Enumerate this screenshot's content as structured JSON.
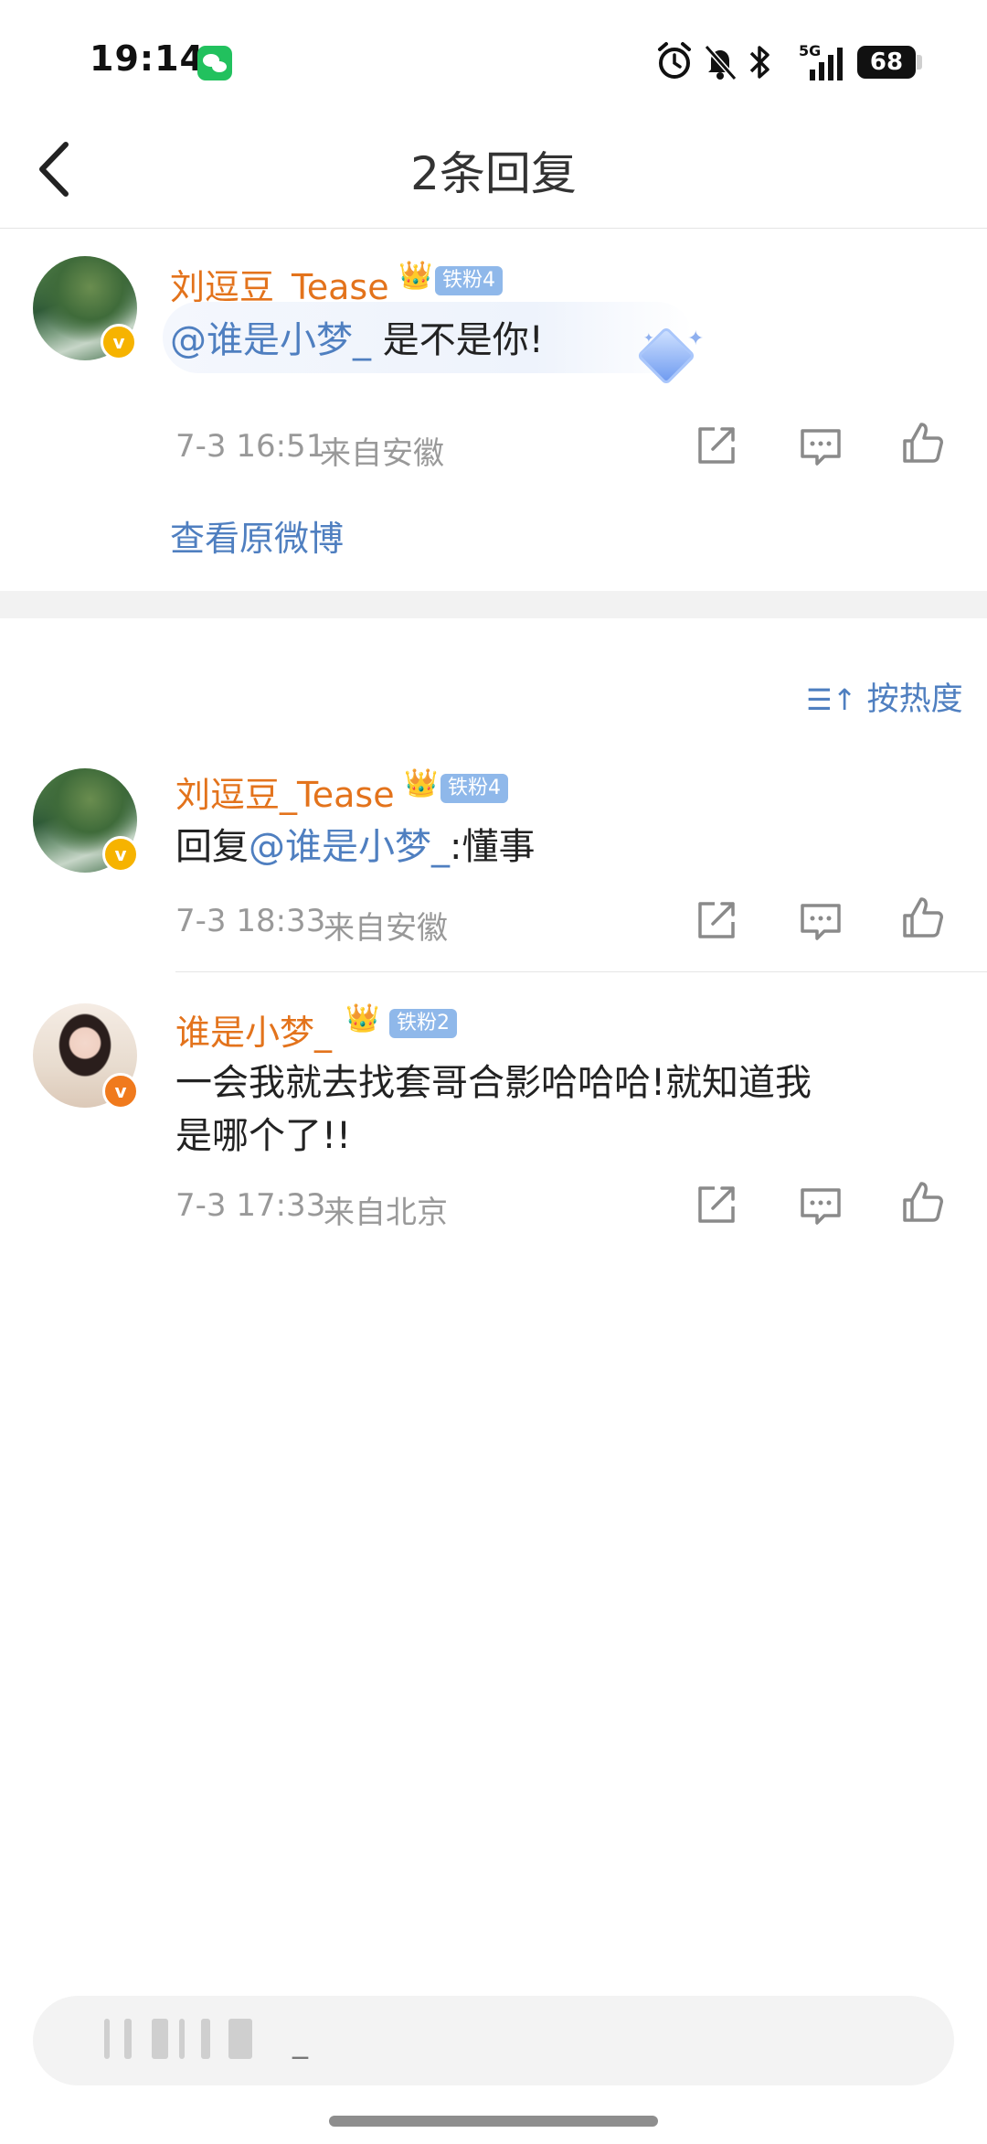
{
  "status_bar": {
    "time": "19:14",
    "network": "5G",
    "battery": "68",
    "icons": [
      "wechat-icon",
      "alarm-icon",
      "bell-off-icon",
      "bluetooth-icon",
      "signal-icon",
      "battery-icon"
    ]
  },
  "nav": {
    "title": "2条回复"
  },
  "root_comment": {
    "username": "刘逗豆_Tease",
    "fan_badge": "铁粉4",
    "mention": "@谁是小梦_",
    "text": "是不是你!",
    "time": "7-3 16:51",
    "location": "来自安徽",
    "view_original": "查看原微博"
  },
  "sort": {
    "label": "按热度"
  },
  "replies": [
    {
      "username": "刘逗豆_Tease",
      "fan_badge": "铁粉4",
      "prefix": "回复",
      "mention": "@谁是小梦_",
      "text": ":懂事",
      "time": "7-3 18:33",
      "location": "来自安徽"
    },
    {
      "username": "谁是小梦_",
      "fan_badge": "铁粉2",
      "text_line1": "一会我就去找套哥合影哈哈哈!就知道我",
      "text_line2": "是哪个了!!",
      "time": "7-3 17:33",
      "location": "来自北京"
    }
  ],
  "input": {
    "placeholder_glyph": "_"
  },
  "colors": {
    "username": "#e3731c",
    "mention": "#4f7fc0",
    "fan_badge": "#8fb8ea",
    "meta": "#999999"
  }
}
